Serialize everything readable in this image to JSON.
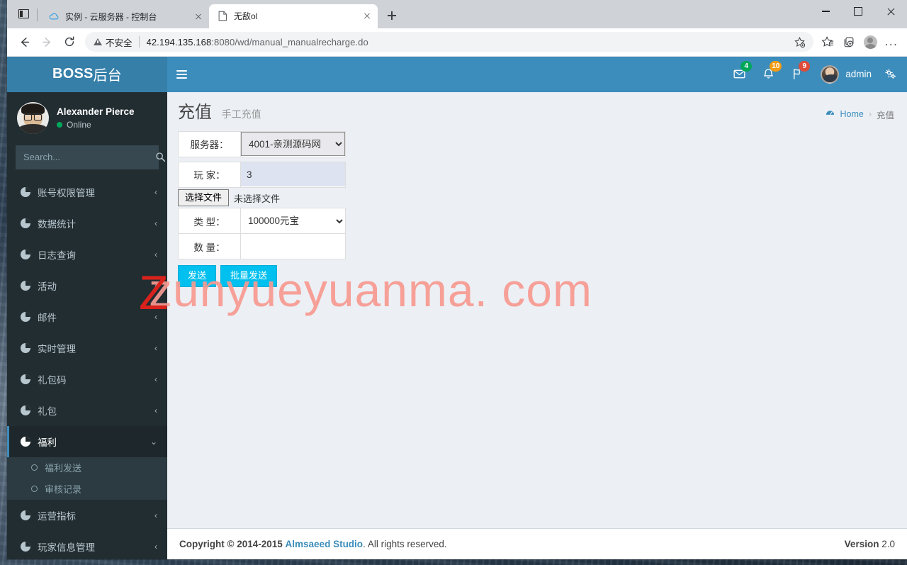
{
  "browser": {
    "tabs": [
      {
        "title": "实例 - 云服务器 - 控制台",
        "active": false,
        "favicon": "cloud-icon"
      },
      {
        "title": "无敌ol",
        "active": true,
        "favicon": "page-icon"
      }
    ],
    "new_tab_label": "+",
    "window_controls": {
      "minimize": "–",
      "maximize": "□",
      "close": "×"
    },
    "toolbar": {
      "back": "←",
      "forward": "→",
      "reload": "⟳",
      "security_label": "不安全",
      "url_host": "42.194.135.168",
      "url_rest": ":8080/wd/manual_manualrecharge.do",
      "favorite_label": "☆",
      "collections_label": "collections",
      "profile_label": "profile",
      "settings_label": "..."
    }
  },
  "app": {
    "logo_bold": "BOSS",
    "logo_cn": "后台",
    "navbar": {
      "toggle_label": "sidebar-toggle",
      "messages": {
        "icon": "envelope-icon",
        "badge": "4",
        "badge_color": "#00a65a"
      },
      "notifications": {
        "icon": "bell-icon",
        "badge": "10",
        "badge_color": "#f39c12"
      },
      "tasks": {
        "icon": "flag-icon",
        "badge": "9",
        "badge_color": "#dd4b39"
      },
      "user_name": "admin",
      "settings_icon": "gear-icon"
    },
    "sidebar": {
      "user": {
        "name": "Alexander Pierce",
        "status": "Online"
      },
      "search_placeholder": "Search...",
      "search_value": "",
      "menu": [
        {
          "label": "账号权限管理",
          "chevron": "‹",
          "active": false
        },
        {
          "label": "数据统计",
          "chevron": "‹",
          "active": false
        },
        {
          "label": "日志查询",
          "chevron": "‹",
          "active": false
        },
        {
          "label": "活动",
          "chevron": "‹",
          "active": false
        },
        {
          "label": "邮件",
          "chevron": "‹",
          "active": false
        },
        {
          "label": "实时管理",
          "chevron": "‹",
          "active": false
        },
        {
          "label": "礼包码",
          "chevron": "‹",
          "active": false
        },
        {
          "label": "礼包",
          "chevron": "‹",
          "active": false
        },
        {
          "label": "福利",
          "chevron": "⌄",
          "active": true,
          "submenu": [
            {
              "label": "福利发送"
            },
            {
              "label": "审核记录"
            }
          ]
        },
        {
          "label": "运营指标",
          "chevron": "‹",
          "active": false
        },
        {
          "label": "玩家信息管理",
          "chevron": "‹",
          "active": false
        }
      ]
    },
    "content": {
      "title": "充值",
      "subtitle": "手工充值",
      "breadcrumb": {
        "home": "Home",
        "separator": "›",
        "current": "充值"
      },
      "form": {
        "server_label": "服务器：",
        "server_value": "4001-亲测源码网",
        "player_label": "玩  家：",
        "player_value": "3",
        "file_button": "选择文件",
        "file_status": "未选择文件",
        "type_label": "类  型：",
        "type_value": "100000元宝",
        "quantity_label": "数  量：",
        "quantity_value": "",
        "send_button": "发送",
        "batch_send_button": "批量发送"
      }
    },
    "watermark": {
      "text": "zunyueyuanma. com",
      "letter": "Z",
      "color": "#f79a91",
      "letter_color": "#d9221c"
    },
    "footer": {
      "copyright_prefix": "Copyright © 2014-2015",
      "studio": "Almsaeed Studio",
      "copyright_suffix": ". All rights reserved.",
      "version_label": "Version",
      "version_number": "2.0"
    }
  }
}
